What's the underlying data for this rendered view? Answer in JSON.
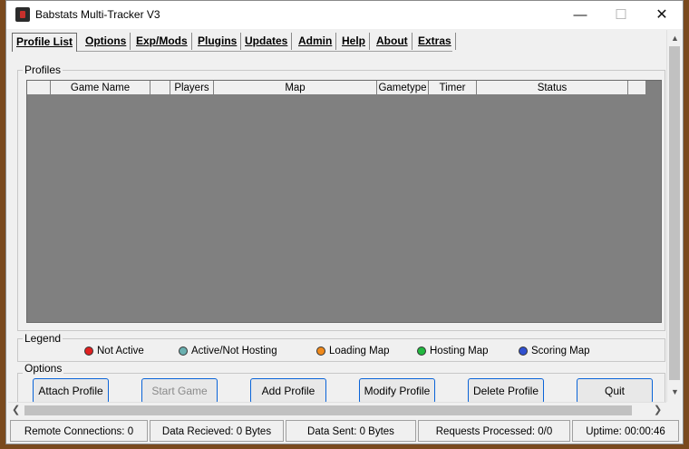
{
  "window": {
    "title": "Babstats Multi-Tracker V3"
  },
  "menu": {
    "tabs": [
      {
        "label": "Profile List"
      },
      {
        "label": "Options"
      },
      {
        "label": "Exp/Mods"
      },
      {
        "label": "Plugins"
      },
      {
        "label": "Updates"
      },
      {
        "label": "Admin"
      },
      {
        "label": "Help"
      },
      {
        "label": "About"
      },
      {
        "label": "Extras"
      }
    ]
  },
  "profiles": {
    "label": "Profiles",
    "columns": [
      "Game Name",
      "",
      "Players",
      "Map",
      "Gametype",
      "Timer",
      "Status"
    ]
  },
  "legend": {
    "label": "Legend",
    "items": [
      {
        "label": "Not Active",
        "color": "#e02020"
      },
      {
        "label": "Active/Not Hosting",
        "color": "#6ab0b0"
      },
      {
        "label": "Loading Map",
        "color": "#f08a1c"
      },
      {
        "label": "Hosting Map",
        "color": "#22b840"
      },
      {
        "label": "Scoring Map",
        "color": "#3050d0"
      }
    ]
  },
  "options": {
    "label": "Options",
    "buttons": [
      {
        "label": "Attach Profile"
      },
      {
        "label": "Start Game"
      },
      {
        "label": "Add Profile"
      },
      {
        "label": "Modify Profile"
      },
      {
        "label": "Delete Profile"
      },
      {
        "label": "Quit"
      }
    ]
  },
  "status": {
    "remote_connections": "Remote Connections: 0",
    "data_received": "Data Recieved: 0 Bytes",
    "data_sent": "Data Sent: 0 Bytes",
    "requests_processed": "Requests Processed: 0/0",
    "uptime": "Uptime: 00:00:46"
  }
}
